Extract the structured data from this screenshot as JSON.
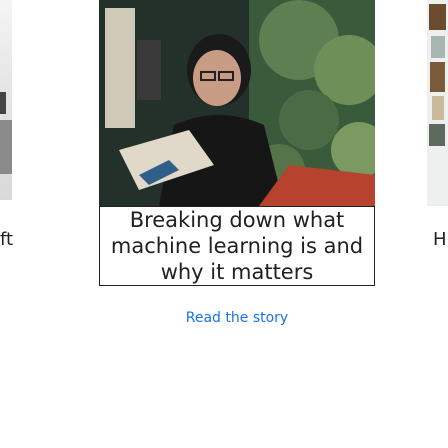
{
  "cards": {
    "left": {
      "headline_fragment": "ft"
    },
    "main": {
      "headline": "Breaking down what machine learning is and why it matters",
      "link_label": "Read the story"
    },
    "right": {
      "headline_fragment": "H"
    }
  },
  "colors": {
    "link": "#1a73e8",
    "text": "#202124",
    "border": "#202124"
  },
  "icons": {
    "main_image": "photo-person-with-glasses-plant-background",
    "right_image": "photo-building-facade"
  }
}
